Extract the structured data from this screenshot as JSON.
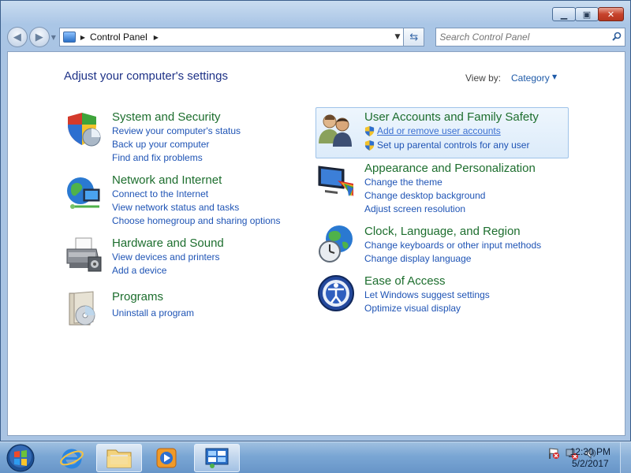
{
  "window": {
    "buttons": {
      "minimize": "▭",
      "maximize": "□",
      "close": "✕"
    }
  },
  "nav": {
    "address": {
      "crumb": "Control Panel"
    },
    "search": {
      "placeholder": "Search Control Panel"
    }
  },
  "content": {
    "heading": "Adjust your computer's settings",
    "view_by": {
      "label": "View by:",
      "value": "Category"
    },
    "categories_left": [
      {
        "title": "System and Security",
        "icon": "shield-icon",
        "links": [
          "Review your computer's status",
          "Back up your computer",
          "Find and fix problems"
        ]
      },
      {
        "title": "Network and Internet",
        "icon": "network-globe-icon",
        "links": [
          "Connect to the Internet",
          "View network status and tasks",
          "Choose homegroup and sharing options"
        ]
      },
      {
        "title": "Hardware and Sound",
        "icon": "printer-icon",
        "links": [
          "View devices and printers",
          "Add a device"
        ]
      },
      {
        "title": "Programs",
        "icon": "programs-icon",
        "links": [
          "Uninstall a program"
        ]
      }
    ],
    "categories_right": [
      {
        "title": "User Accounts and Family Safety",
        "icon": "users-icon",
        "links": [
          "Add or remove user accounts",
          "Set up parental controls for any user"
        ]
      },
      {
        "title": "Appearance and Personalization",
        "icon": "monitor-palette-icon",
        "links": [
          "Change the theme",
          "Change desktop background",
          "Adjust screen resolution"
        ]
      },
      {
        "title": "Clock, Language, and Region",
        "icon": "clock-globe-icon",
        "links": [
          "Change keyboards or other input methods",
          "Change display language"
        ]
      },
      {
        "title": "Ease of Access",
        "icon": "ease-of-access-icon",
        "links": [
          "Let Windows suggest settings",
          "Optimize visual display"
        ]
      }
    ]
  },
  "taskbar": {
    "clock": {
      "time": "12:30 PM",
      "date": "5/2/2017"
    }
  },
  "colors": {
    "category_title": "#1d6e2e",
    "link": "#1f54b5",
    "heading": "#1e3287"
  }
}
